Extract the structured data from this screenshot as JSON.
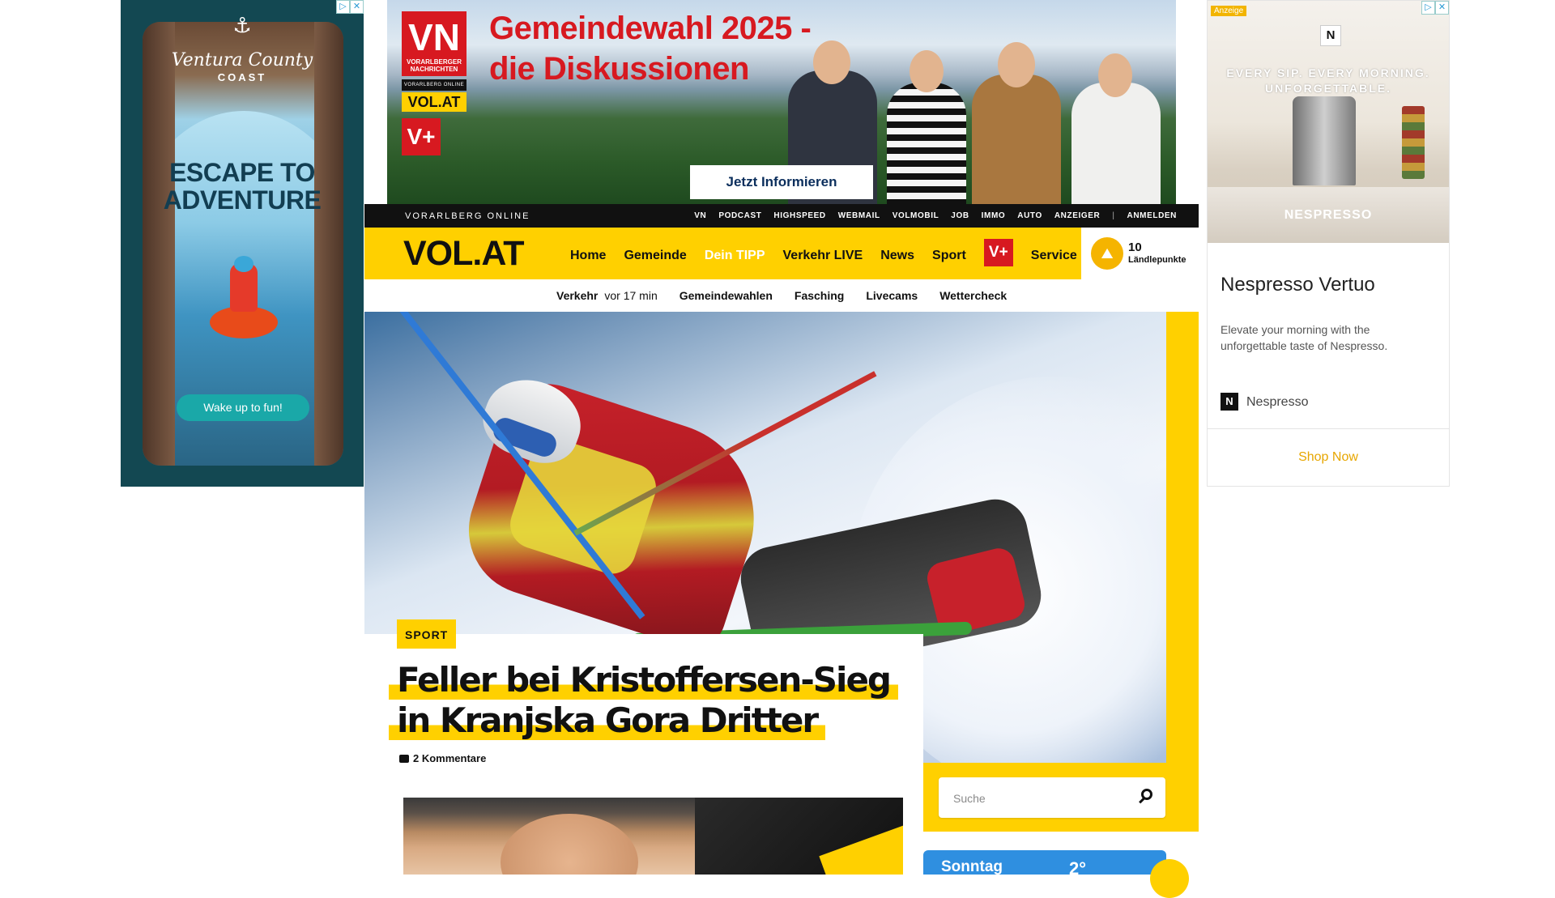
{
  "ad_left": {
    "brand_line1": "Ventura County",
    "brand_line2": "COAST",
    "headline": "ESCAPE TO ADVENTURE",
    "cta": "Wake up to fun!"
  },
  "ad_top": {
    "logo_letters": "VN",
    "logo_caption": "VORARLBERGER NACHRICHTEN",
    "sub_caption": "VORARLBERG ONLINE",
    "badge": "VOL.AT",
    "vplus": "V+",
    "title_line1": "Gemeindewahl 2025 -",
    "title_line2": "die Diskussionen",
    "cta": "Jetzt Informieren"
  },
  "ad_right": {
    "tag": "Anzeige",
    "logo_letter": "N",
    "slogan_line1": "EVERY SIP. EVERY MORNING.",
    "slogan_line2": "UNFORGETTABLE.",
    "wordmark": "NESPRESSO",
    "title": "Nespresso Vertuo",
    "text": "Elevate your morning with the unforgettable taste of Nespresso.",
    "advertiser": "Nespresso",
    "cta": "Shop Now"
  },
  "topbar": {
    "site_label": "VORARLBERG ONLINE",
    "links": [
      "VN",
      "PODCAST",
      "HIGHSPEED",
      "WEBMAIL",
      "VOLMOBIL",
      "JOB",
      "IMMO",
      "AUTO",
      "ANZEIGER"
    ],
    "separator": "|",
    "login": "ANMELDEN"
  },
  "nav": {
    "logo": "VOL.AT",
    "items": [
      "Home",
      "Gemeinde",
      "Dein TIPP",
      "Verkehr LIVE",
      "News",
      "Sport"
    ],
    "vplus": "V+",
    "service": "Service"
  },
  "points": {
    "count": "10",
    "label": "Ländlepunkte"
  },
  "subnav": {
    "traffic": "Verkehr",
    "traffic_age": "vor 17 min",
    "items": [
      "Gemeindewahlen",
      "Fasching",
      "Livecams",
      "Wettercheck"
    ]
  },
  "hero": {
    "category": "SPORT",
    "title": "Feller bei Kristoffersen-Sieg in Kranjska Gora Dritter",
    "comments": "2 Kommentare"
  },
  "search": {
    "placeholder": "Suche"
  },
  "weather": {
    "day": "Sonntag",
    "temp": "2°"
  },
  "colors": {
    "brand_yellow": "#ffd000",
    "brand_red": "#d71920",
    "weather_blue": "#2f8fe0"
  }
}
